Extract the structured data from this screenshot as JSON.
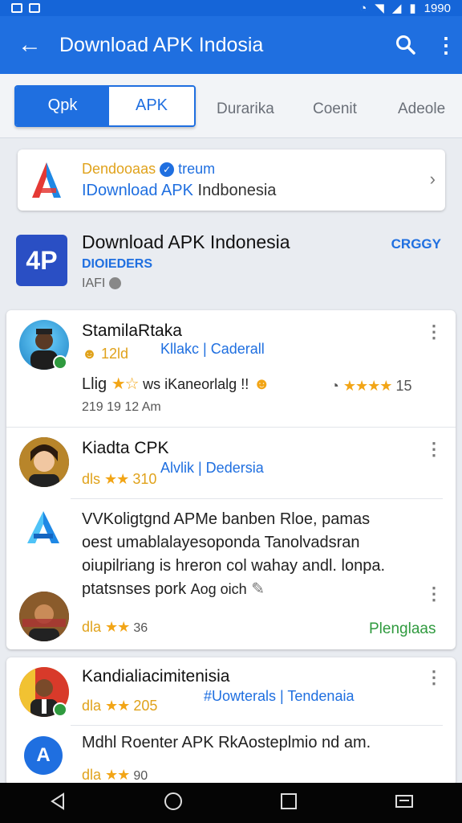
{
  "status": {
    "time": "1990"
  },
  "appbar": {
    "title": "Download APK Indosia"
  },
  "tabs": {
    "active": "Qpk",
    "second": "APK",
    "t3": "Durarika",
    "t4": "Coenit",
    "t5": "Adeole"
  },
  "source": {
    "line1_a": "Dendooaas",
    "line1_b": "treum",
    "line2_a": "IDownload APK",
    "line2_b": " Indbonesia"
  },
  "hero": {
    "title": "Download APK Indonesia",
    "subtitle": "DIOIEDERS",
    "meta": "IAFI",
    "cta": "CRGGY",
    "icon_text": "4P"
  },
  "posts": [
    {
      "name": "StamilaRtaka",
      "count": "12ld",
      "tags": "Kllakc | Caderall",
      "text": "Llig",
      "text2": "ws iKaneorlalg !!",
      "rating": "15",
      "time": "219 19 12 Am"
    },
    {
      "name": "Kiadta CPK",
      "count": "dls",
      "count2": "310",
      "tags": "Alvlik | Dedersia"
    },
    {
      "line1": "VVKoligtgnd APMe banben Rloe, pamas",
      "line2": "oest umablalayesoponda Tanolvadsran",
      "line3": "oiupilriang is hreron col wahay andl. lonpa.",
      "line4": "ptatsnses pork",
      "line4b": "Aog oich"
    },
    {
      "count": "dla",
      "count2": "36",
      "action": "Plenglaas"
    }
  ],
  "post3": {
    "name": "Kandialiacimitenisia",
    "count": "dla",
    "count2": "205",
    "tags": "#Uowterals | Tendenaia",
    "text": "Mdhl Roenter APK RkAosteplmio nd am.",
    "count3": "dla",
    "count4": "90"
  }
}
